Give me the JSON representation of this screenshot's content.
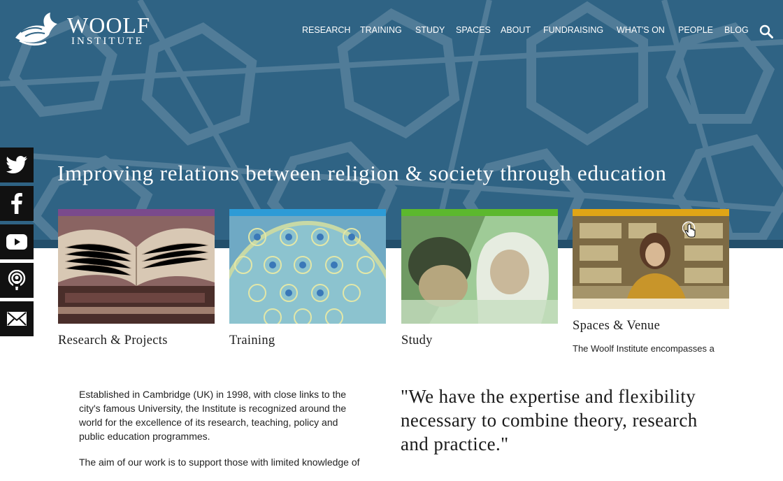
{
  "brand": {
    "name_line1": "WOOLF",
    "name_line2": "INSTITUTE"
  },
  "nav": {
    "items": [
      {
        "label": "RESEARCH"
      },
      {
        "label": "TRAINING"
      },
      {
        "label": "STUDY"
      },
      {
        "label": "SPACES"
      },
      {
        "label": "ABOUT"
      },
      {
        "label": "FUNDRAISING"
      },
      {
        "label": "WHAT'S ON"
      },
      {
        "label": "PEOPLE"
      },
      {
        "label": "BLOG"
      }
    ],
    "search_icon": "search-icon"
  },
  "hero": {
    "tagline": "Improving relations between religion & society through education"
  },
  "social": [
    "twitter-icon",
    "facebook-icon",
    "youtube-icon",
    "podcast-icon",
    "email-icon"
  ],
  "cards": [
    {
      "title": "Research & Projects",
      "accent": "#7a4a8c"
    },
    {
      "title": "Training",
      "accent": "#2d9bd6"
    },
    {
      "title": "Study",
      "accent": "#5cb82e"
    },
    {
      "title": "Spaces & Venue",
      "accent": "#e0a516",
      "description": "The Woolf Institute encompasses a"
    }
  ],
  "about": {
    "paragraph1": "Established in Cambridge (UK) in 1998, with close links to the city's famous University, the Institute is recognized around the world for the excellence of its research, teaching, policy and public education programmes.",
    "paragraph2": "The aim of our work is to support those with limited knowledge of"
  },
  "quote": {
    "text": "\"We have the expertise and flexibility necessary to combine theory, research and practice.\""
  },
  "colors": {
    "hero_bg": "#2f6384",
    "hero_band": "#234f6b",
    "social_bg": "#111111"
  }
}
